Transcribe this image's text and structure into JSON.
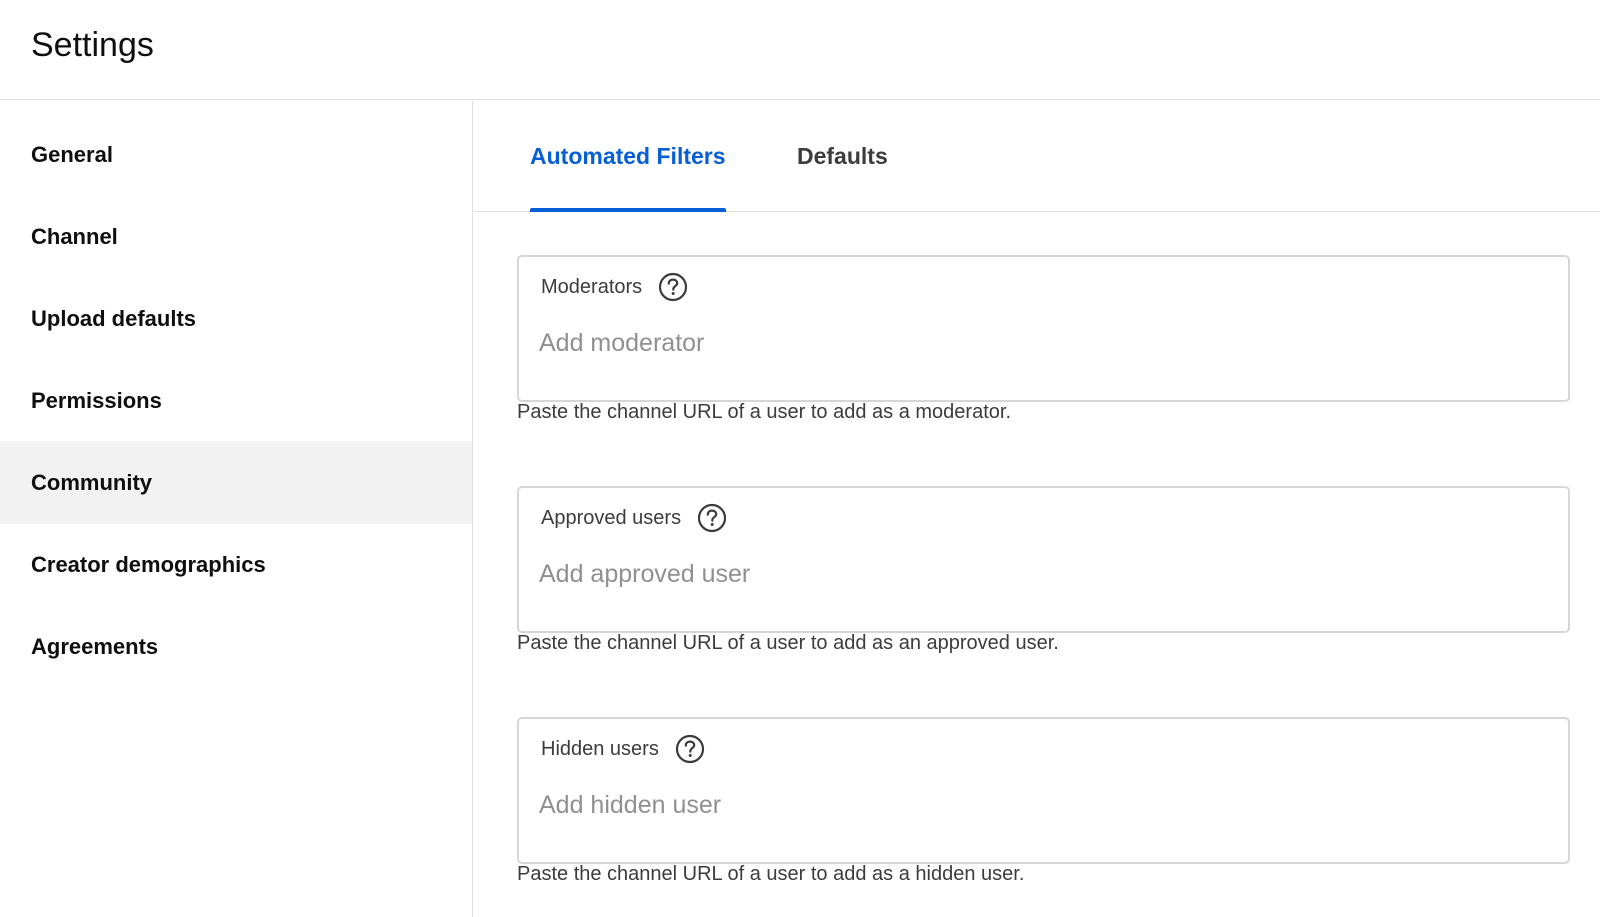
{
  "header": {
    "title": "Settings"
  },
  "sidebar": {
    "items": [
      {
        "label": "General"
      },
      {
        "label": "Channel"
      },
      {
        "label": "Upload defaults"
      },
      {
        "label": "Permissions"
      },
      {
        "label": "Community",
        "active": true
      },
      {
        "label": "Creator demographics"
      },
      {
        "label": "Agreements"
      }
    ]
  },
  "tabs": [
    {
      "label": "Automated Filters",
      "active": true
    },
    {
      "label": "Defaults"
    }
  ],
  "fields": [
    {
      "label": "Moderators",
      "placeholder": "Add moderator",
      "value": "",
      "hint": "Paste the channel URL of a user to add as a moderator."
    },
    {
      "label": "Approved users",
      "placeholder": "Add approved user",
      "value": "",
      "hint": "Paste the channel URL of a user to add as an approved user."
    },
    {
      "label": "Hidden users",
      "placeholder": "Add hidden user",
      "value": "",
      "hint": "Paste the channel URL of a user to add as a hidden user."
    }
  ],
  "icons": {
    "help": "help-circle-icon"
  },
  "colors": {
    "accent": "#065fd4",
    "active_nav_bg": "#f2f2f2",
    "border": "#d6d6d6"
  }
}
